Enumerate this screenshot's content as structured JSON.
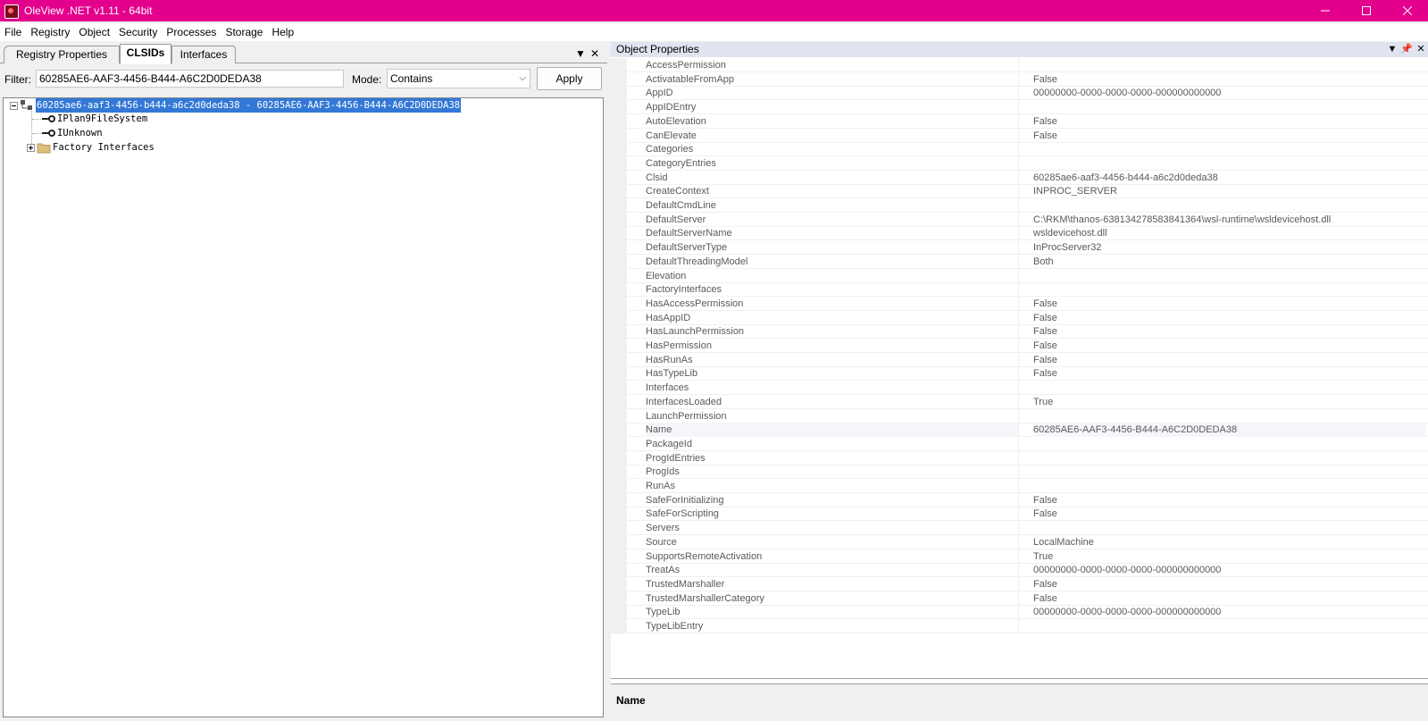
{
  "window": {
    "title": "OleView .NET v1.11 - 64bit",
    "title_bg": "#e3008c"
  },
  "menu": [
    "File",
    "Registry",
    "Object",
    "Security",
    "Processes",
    "Storage",
    "Help"
  ],
  "left": {
    "tabs": [
      "Registry Properties",
      "CLSIDs",
      "Interfaces"
    ],
    "active_tab": "CLSIDs",
    "filter_label": "Filter:",
    "filter_value": "60285AE6-AAF3-4456-B444-A6C2D0DEDA38",
    "mode_label": "Mode:",
    "mode_value": "Contains",
    "apply_label": "Apply",
    "tree": {
      "root": "60285ae6-aaf3-4456-b444-a6c2d0deda38 - 60285AE6-AAF3-4456-B444-A6C2D0DEDA38",
      "children": [
        "IPlan9FileSystem",
        "IUnknown",
        "Factory Interfaces"
      ]
    }
  },
  "right": {
    "header": "Object Properties",
    "properties": [
      {
        "name": "AccessPermission",
        "value": ""
      },
      {
        "name": "ActivatableFromApp",
        "value": "False"
      },
      {
        "name": "AppID",
        "value": "00000000-0000-0000-0000-000000000000"
      },
      {
        "name": "AppIDEntry",
        "value": ""
      },
      {
        "name": "AutoElevation",
        "value": "False"
      },
      {
        "name": "CanElevate",
        "value": "False"
      },
      {
        "name": "Categories",
        "value": ""
      },
      {
        "name": "CategoryEntries",
        "value": ""
      },
      {
        "name": "Clsid",
        "value": "60285ae6-aaf3-4456-b444-a6c2d0deda38"
      },
      {
        "name": "CreateContext",
        "value": "INPROC_SERVER"
      },
      {
        "name": "DefaultCmdLine",
        "value": ""
      },
      {
        "name": "DefaultServer",
        "value": "C:\\RKM\\thanos-638134278583841364\\wsl-runtime\\wsldevicehost.dll"
      },
      {
        "name": "DefaultServerName",
        "value": "wsldevicehost.dll"
      },
      {
        "name": "DefaultServerType",
        "value": "InProcServer32"
      },
      {
        "name": "DefaultThreadingModel",
        "value": "Both"
      },
      {
        "name": "Elevation",
        "value": ""
      },
      {
        "name": "FactoryInterfaces",
        "value": ""
      },
      {
        "name": "HasAccessPermission",
        "value": "False"
      },
      {
        "name": "HasAppID",
        "value": "False"
      },
      {
        "name": "HasLaunchPermission",
        "value": "False"
      },
      {
        "name": "HasPermission",
        "value": "False"
      },
      {
        "name": "HasRunAs",
        "value": "False"
      },
      {
        "name": "HasTypeLib",
        "value": "False"
      },
      {
        "name": "Interfaces",
        "value": ""
      },
      {
        "name": "InterfacesLoaded",
        "value": "True"
      },
      {
        "name": "LaunchPermission",
        "value": ""
      },
      {
        "name": "Name",
        "value": "60285AE6-AAF3-4456-B444-A6C2D0DEDA38"
      },
      {
        "name": "PackageId",
        "value": ""
      },
      {
        "name": "ProgIdEntries",
        "value": ""
      },
      {
        "name": "ProgIds",
        "value": ""
      },
      {
        "name": "RunAs",
        "value": ""
      },
      {
        "name": "SafeForInitializing",
        "value": "False"
      },
      {
        "name": "SafeForScripting",
        "value": "False"
      },
      {
        "name": "Servers",
        "value": ""
      },
      {
        "name": "Source",
        "value": "LocalMachine"
      },
      {
        "name": "SupportsRemoteActivation",
        "value": "True"
      },
      {
        "name": "TreatAs",
        "value": "00000000-0000-0000-0000-000000000000"
      },
      {
        "name": "TrustedMarshaller",
        "value": "False"
      },
      {
        "name": "TrustedMarshallerCategory",
        "value": "False"
      },
      {
        "name": "TypeLib",
        "value": "00000000-0000-0000-0000-000000000000"
      },
      {
        "name": "TypeLibEntry",
        "value": ""
      }
    ],
    "selected_property": "Name",
    "description_title": "Name"
  }
}
